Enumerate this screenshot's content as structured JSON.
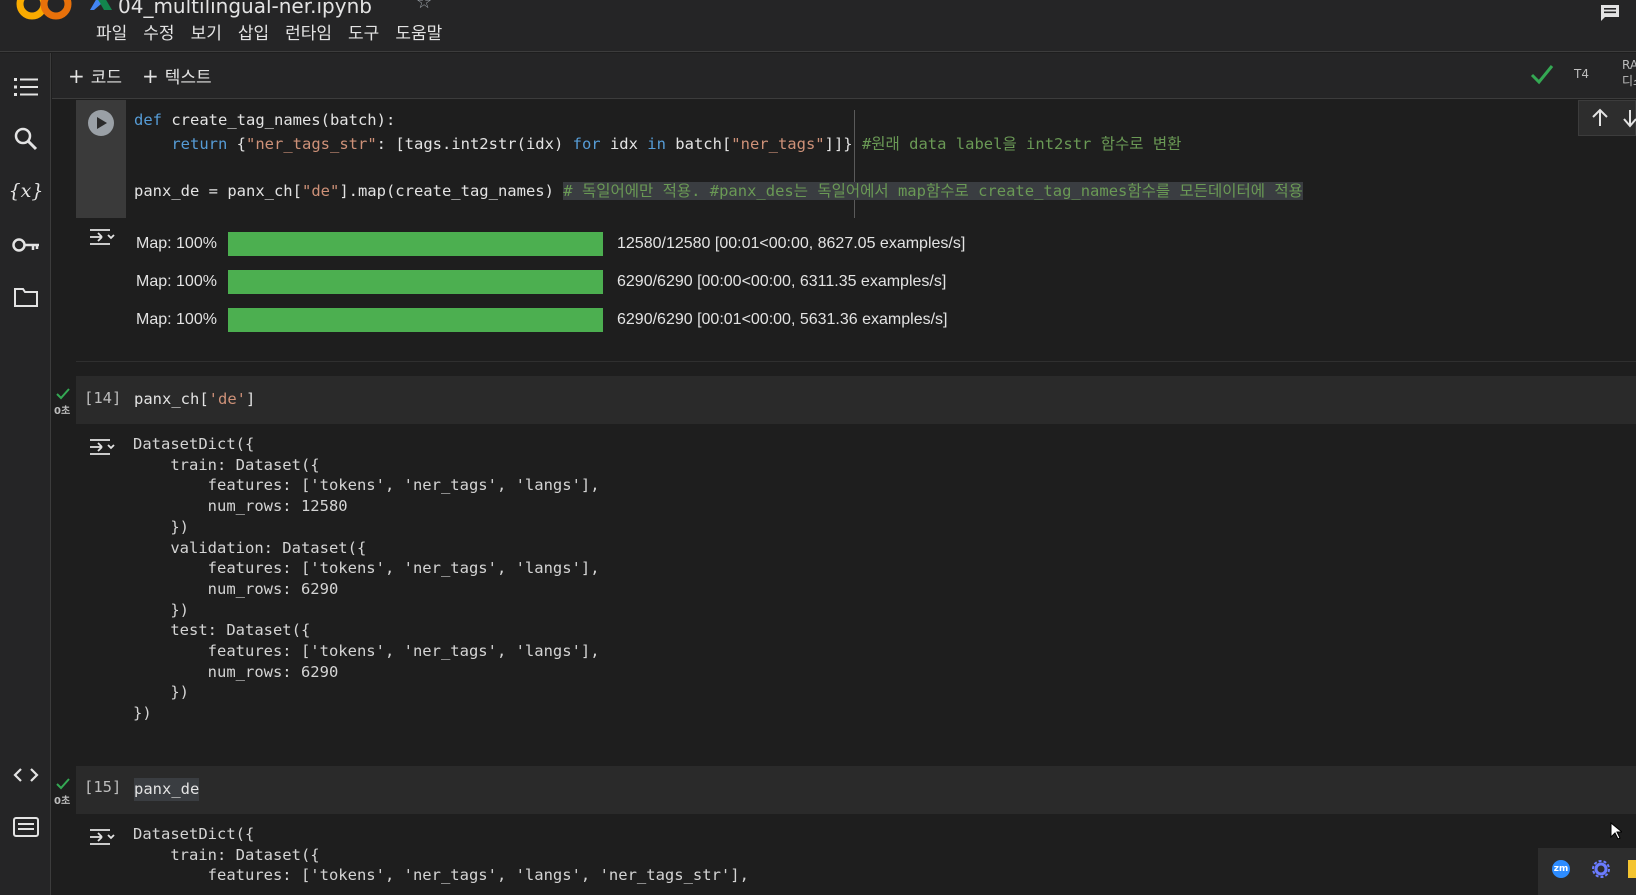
{
  "header": {
    "title": "04_multilingual-ner.ipynb",
    "menu": [
      "파일",
      "수정",
      "보기",
      "삽입",
      "런타임",
      "도구",
      "도움말"
    ]
  },
  "toolbar": {
    "add_code": "코드",
    "add_text": "텍스트",
    "runtime_type": "T4",
    "resource_top": "RA",
    "resource_bottom": "디스크"
  },
  "sidebar": {
    "items": [
      "table-of-contents-icon",
      "search-icon",
      "variables-icon",
      "secrets-key-icon",
      "files-folder-icon",
      "code-snippets-icon",
      "terminal-icon"
    ]
  },
  "cell1": {
    "code_line1": {
      "kw": "def",
      "rest": " create_tag_names(batch):"
    },
    "code_line2": {
      "indent": "    ",
      "kw_return": "return",
      "open": " {",
      "key": "\"ner_tags_str\"",
      "mid": ": [tags.int2str(idx) ",
      "kw_for": "for",
      "mid2": " idx ",
      "kw_in": "in",
      "mid3": " batch[",
      "key2": "\"ner_tags\"",
      "close": "]]}",
      "comment": " #원래 data label을 int2str 함수로 변환"
    },
    "code_line3": {
      "pre": "panx_de = panx_ch[",
      "key": "\"de\"",
      "post": "].map(create_tag_names) ",
      "comment": "# 독일어에만 적용. #panx_des는 독일어에서 map함수로 create_tag_names함수를 모든데이터에 적용"
    },
    "progress": [
      {
        "label": "Map: 100%",
        "fraction": 1.0,
        "stats": "12580/12580  [00:01<00:00,  8627.05  examples/s]"
      },
      {
        "label": "Map: 100%",
        "fraction": 1.0,
        "stats": "6290/6290  [00:00<00:00,  6311.35  examples/s]"
      },
      {
        "label": "Map: 100%",
        "fraction": 1.0,
        "stats": "6290/6290  [00:01<00:00,  5631.36  examples/s]"
      }
    ]
  },
  "cell2": {
    "exec_count": "[14]",
    "exec_time": "0초",
    "code_pre": "panx_ch[",
    "code_key": "'de'",
    "code_post": "]",
    "output": "DatasetDict({\n    train: Dataset({\n        features: ['tokens', 'ner_tags', 'langs'],\n        num_rows: 12580\n    })\n    validation: Dataset({\n        features: ['tokens', 'ner_tags', 'langs'],\n        num_rows: 6290\n    })\n    test: Dataset({\n        features: ['tokens', 'ner_tags', 'langs'],\n        num_rows: 6290\n    })\n})"
  },
  "cell3": {
    "exec_count": "[15]",
    "exec_time": "0초",
    "code": "panx_de",
    "output": "DatasetDict({\n    train: Dataset({\n        features: ['tokens', 'ner_tags', 'langs', 'ner_tags_str'],"
  },
  "tray": {
    "zoom_badge": "zm"
  },
  "colors": {
    "progress_fill": "#4caf50",
    "check_green": "#34a853",
    "keyword": "#569cd6",
    "string": "#ce9178",
    "comment": "#6a9955"
  }
}
